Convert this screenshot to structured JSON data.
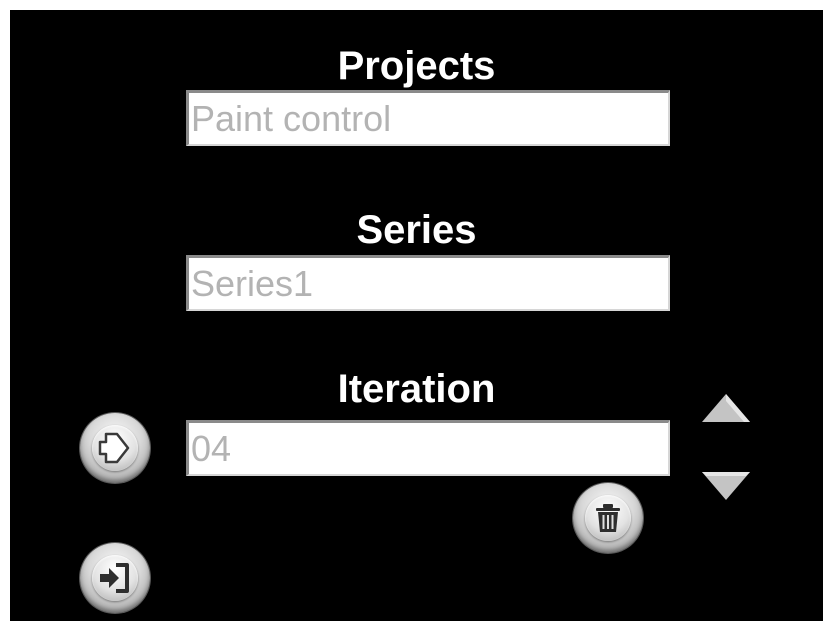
{
  "projects": {
    "heading": "Projects",
    "value": "Paint control"
  },
  "series": {
    "heading": "Series",
    "value": "Series1"
  },
  "iteration": {
    "heading": "Iteration",
    "value": "04"
  },
  "icons": {
    "go": "arrow-right-icon",
    "delete": "trash-icon",
    "login": "sign-in-icon",
    "up": "triangle-up-icon",
    "down": "triangle-down-icon"
  },
  "colors": {
    "background": "#000000",
    "heading_text": "#ffffff",
    "field_text": "#b3b3b3",
    "arrow": "#c4c4c4"
  }
}
